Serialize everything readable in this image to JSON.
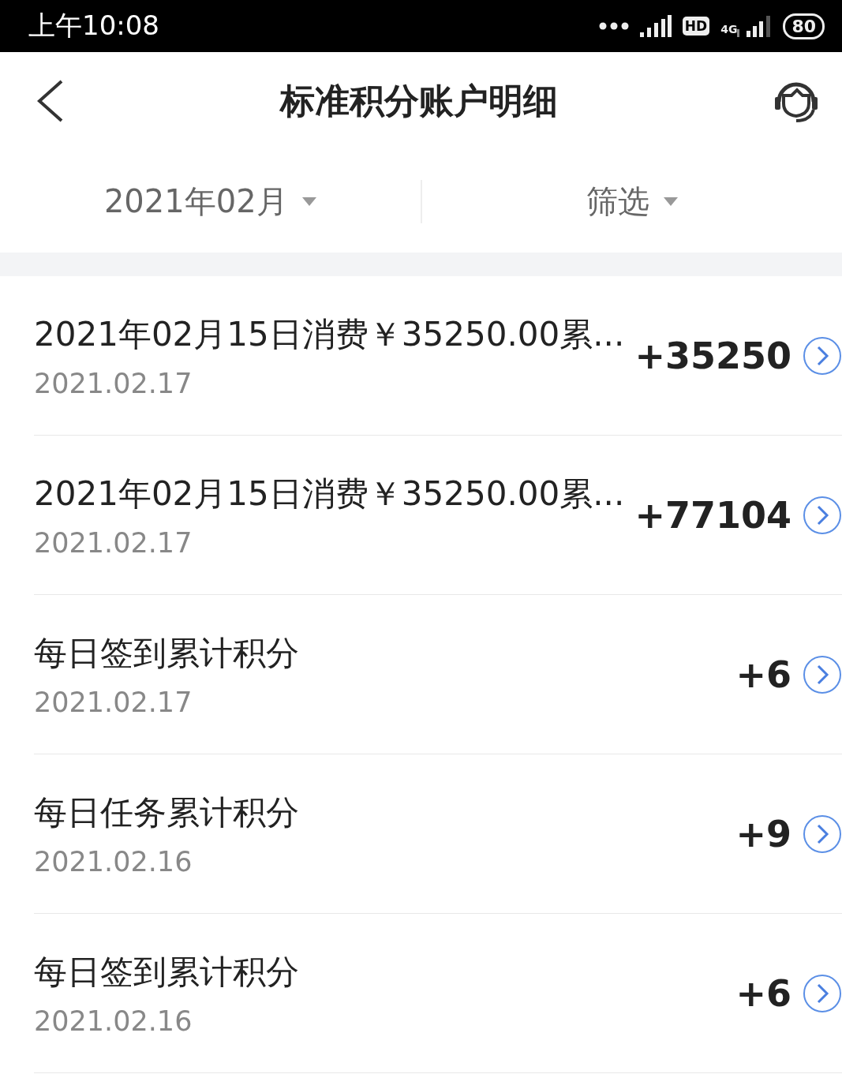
{
  "status_bar": {
    "time": "上午10:08",
    "network": "4G",
    "hd": "HD",
    "battery": "80"
  },
  "header": {
    "title": "标准积分账户明细"
  },
  "filters": [
    {
      "label": "2021年02月"
    },
    {
      "label": "筛选"
    }
  ],
  "records": [
    {
      "title": "2021年02月15日消费￥35250.00累...",
      "date": "2021.02.17",
      "points": "+35250"
    },
    {
      "title": "2021年02月15日消费￥35250.00累...",
      "date": "2021.02.17",
      "points": "+77104"
    },
    {
      "title": "每日签到累计积分",
      "date": "2021.02.17",
      "points": "+6"
    },
    {
      "title": "每日任务累计积分",
      "date": "2021.02.16",
      "points": "+9"
    },
    {
      "title": "每日签到累计积分",
      "date": "2021.02.16",
      "points": "+6"
    }
  ]
}
